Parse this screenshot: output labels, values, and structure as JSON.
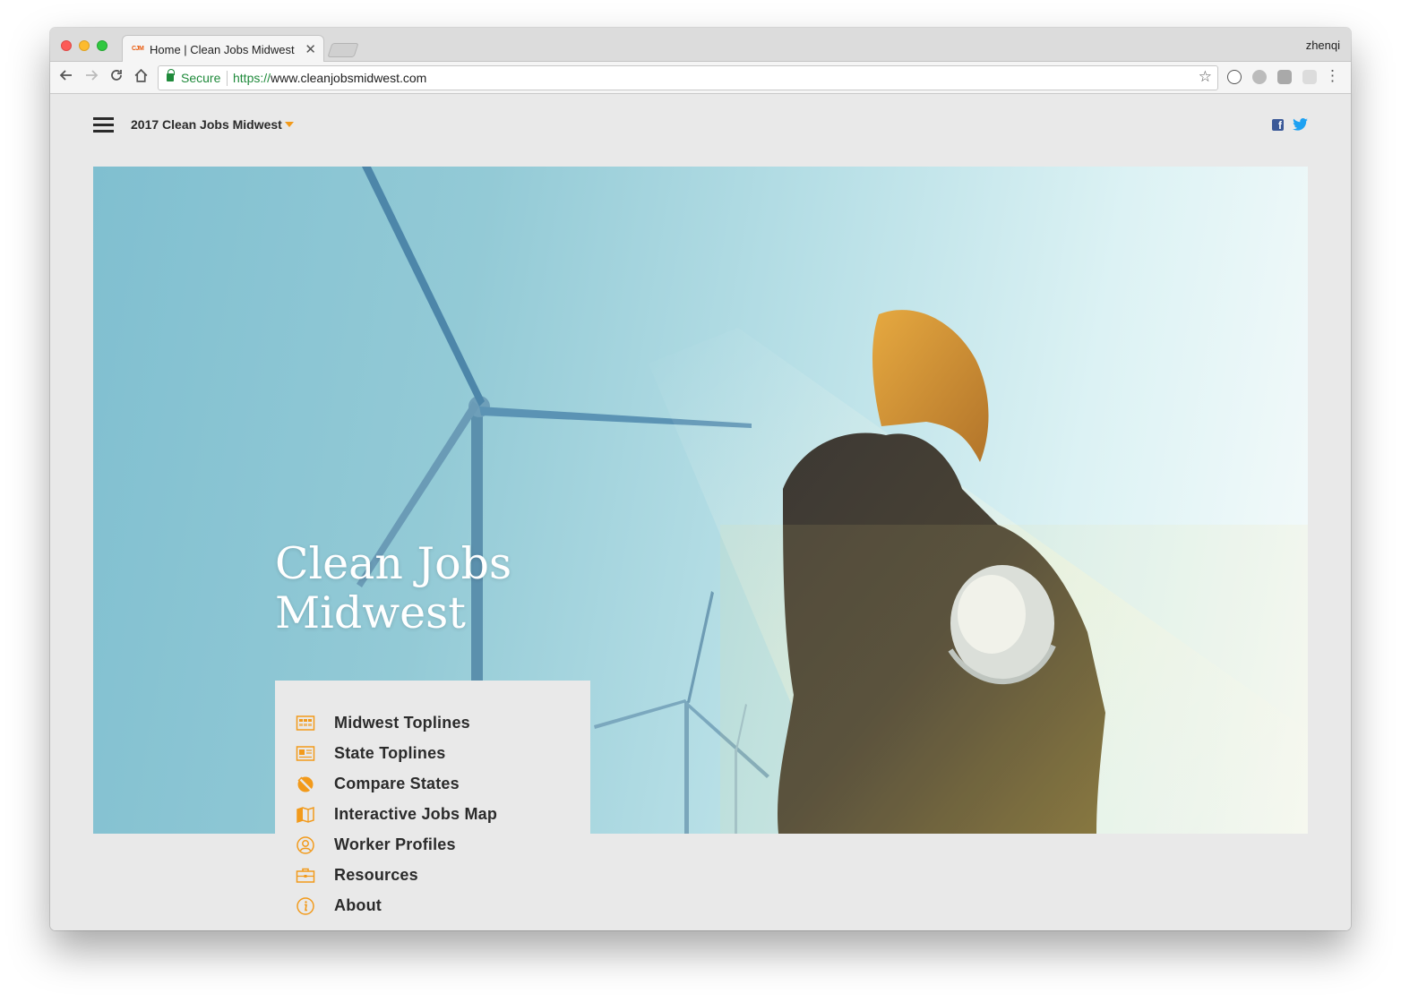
{
  "browser": {
    "tab_favicon": "CJM",
    "tab_title": "Home | Clean Jobs Midwest",
    "tab_close": "✕",
    "profile_name": "zhenqi",
    "secure_label": "Secure",
    "url_scheme": "https://",
    "url_host": "www.cleanjobsmidwest.com"
  },
  "site": {
    "selector_label": "2017 Clean Jobs Midwest",
    "facebook_glyph": "f",
    "hero_title_line1": "Clean Jobs",
    "hero_title_line2": "Midwest"
  },
  "nav": {
    "items": [
      {
        "label": "Midwest Toplines",
        "icon": "grid-icon"
      },
      {
        "label": "State Toplines",
        "icon": "state-card-icon"
      },
      {
        "label": "Compare States",
        "icon": "compare-icon"
      },
      {
        "label": "Interactive Jobs Map",
        "icon": "map-icon"
      },
      {
        "label": "Worker Profiles",
        "icon": "person-icon"
      },
      {
        "label": "Resources",
        "icon": "briefcase-icon"
      },
      {
        "label": "About",
        "icon": "info-icon"
      }
    ]
  },
  "colors": {
    "accent": "#f29a1b",
    "text_dark": "#2b2b2b",
    "page_bg": "#e9e9e9",
    "secure_green": "#1f8a3b"
  }
}
